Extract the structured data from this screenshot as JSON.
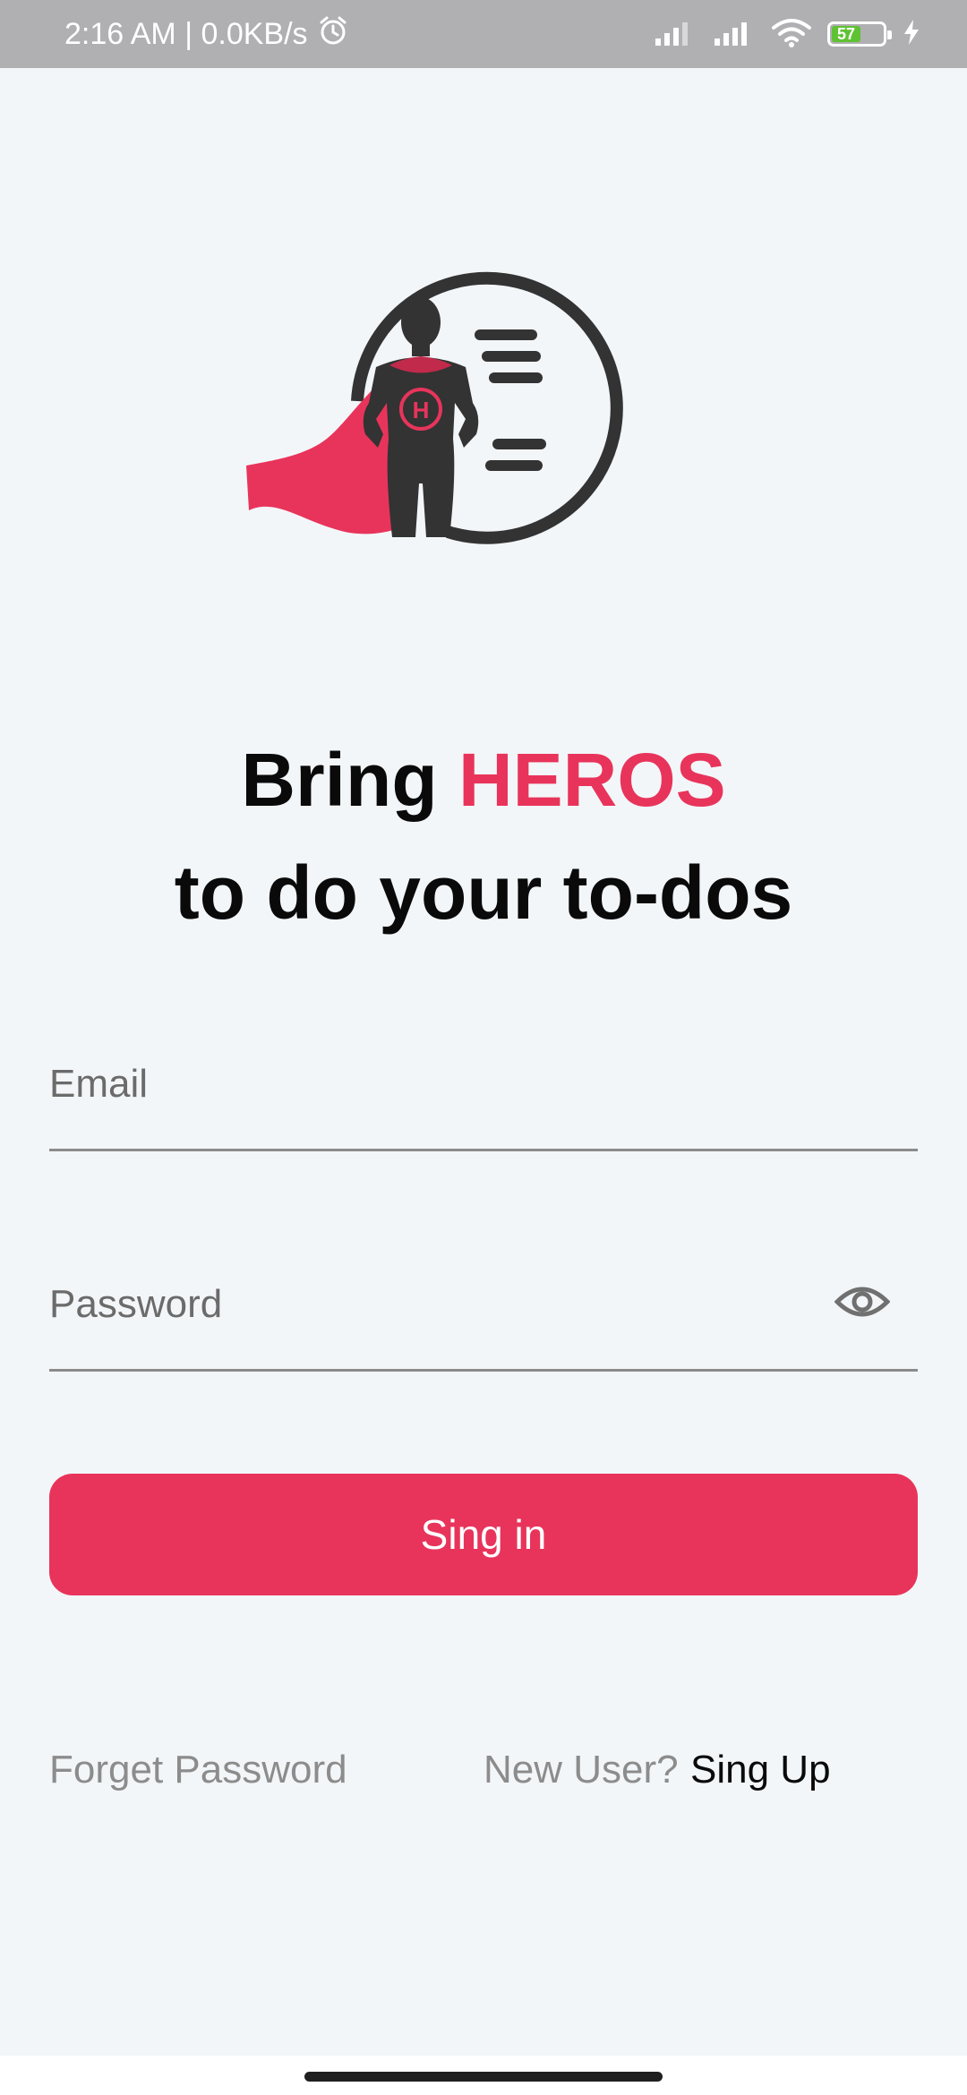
{
  "status_bar": {
    "time_speed": "2:16 AM | 0.0KB/s",
    "battery_level": "57",
    "battery_fraction": 0.57,
    "icons": [
      "alarm-icon",
      "signal-icon",
      "signal-icon",
      "wifi-icon",
      "battery-icon",
      "charging-icon"
    ]
  },
  "logo": {
    "emblem_letter": "H",
    "colors": {
      "dark": "#333333",
      "accent": "#e8345b"
    }
  },
  "headline": {
    "line1_prefix": "Bring ",
    "line1_accent": "HEROS",
    "line2": "to do your to-dos"
  },
  "form": {
    "email_label": "Email",
    "email_value": "",
    "password_label": "Password",
    "password_value": "",
    "password_toggle_icon": "eye-icon"
  },
  "actions": {
    "signin_label": "Sing in",
    "forget_password": "Forget Password",
    "new_user_prompt": "New User?",
    "signup_label": "Sing Up"
  },
  "colors": {
    "accent": "#e8345b",
    "background": "#f3f6f9",
    "text_dark": "#0a0a0a",
    "text_muted": "#8c8c8c"
  }
}
